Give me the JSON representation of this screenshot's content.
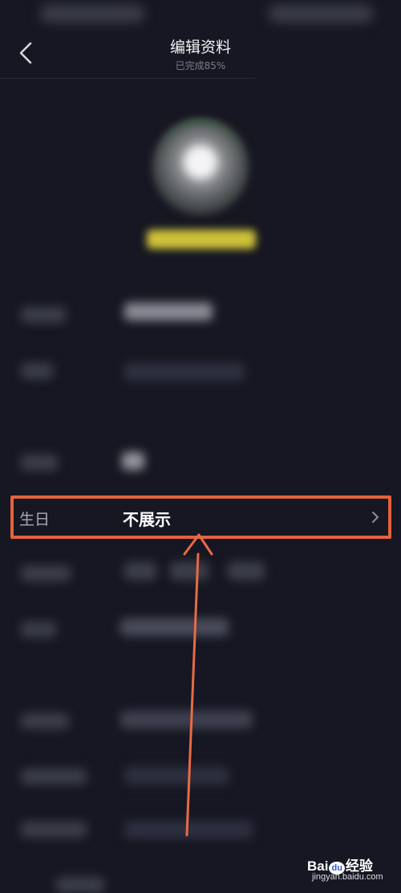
{
  "colors": {
    "background": "#161722",
    "highlight_border": "#e2633d",
    "arrow": "#e86b44",
    "badge": "#cfc23a"
  },
  "header": {
    "title": "编辑资料",
    "subtitle": "已完成85%",
    "back_icon": "chevron-left-icon"
  },
  "birthday_row": {
    "label": "生日",
    "value": "不展示",
    "chevron_icon": "chevron-right-icon"
  },
  "watermark": {
    "brand_prefix": "Bai",
    "brand_paw": "du",
    "brand_suffix": "经验",
    "domain": "jingyan.baidu.com"
  }
}
